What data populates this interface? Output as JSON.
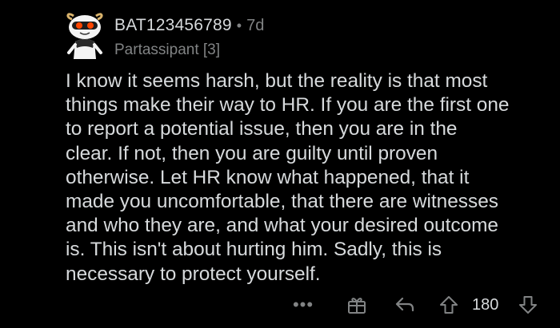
{
  "comment": {
    "author": {
      "username": "BAT123456789",
      "separator": "•",
      "age": "7d",
      "flair": "Partassipant [3]"
    },
    "body_lines": [
      "I know it seems harsh, but the reality is that most",
      "things make their way to HR. If you are the first one",
      "to report a potential issue, then you are in the",
      "clear. If not, then you are guilty until proven",
      "otherwise. Let HR know what happened, that it",
      "made you uncomfortable, that there are witnesses",
      "and who they are, and what your desired outcome",
      "is. This isn't about hurting him. Sadly, this is",
      "necessary to protect yourself."
    ],
    "actions": {
      "more_label": "•••",
      "score": "180",
      "icons": [
        "more-options-icon",
        "award-icon",
        "reply-icon",
        "upvote-icon",
        "downvote-icon"
      ]
    }
  },
  "colors": {
    "background": "#000000",
    "text_primary": "#d7dadc",
    "text_secondary": "#818384"
  }
}
